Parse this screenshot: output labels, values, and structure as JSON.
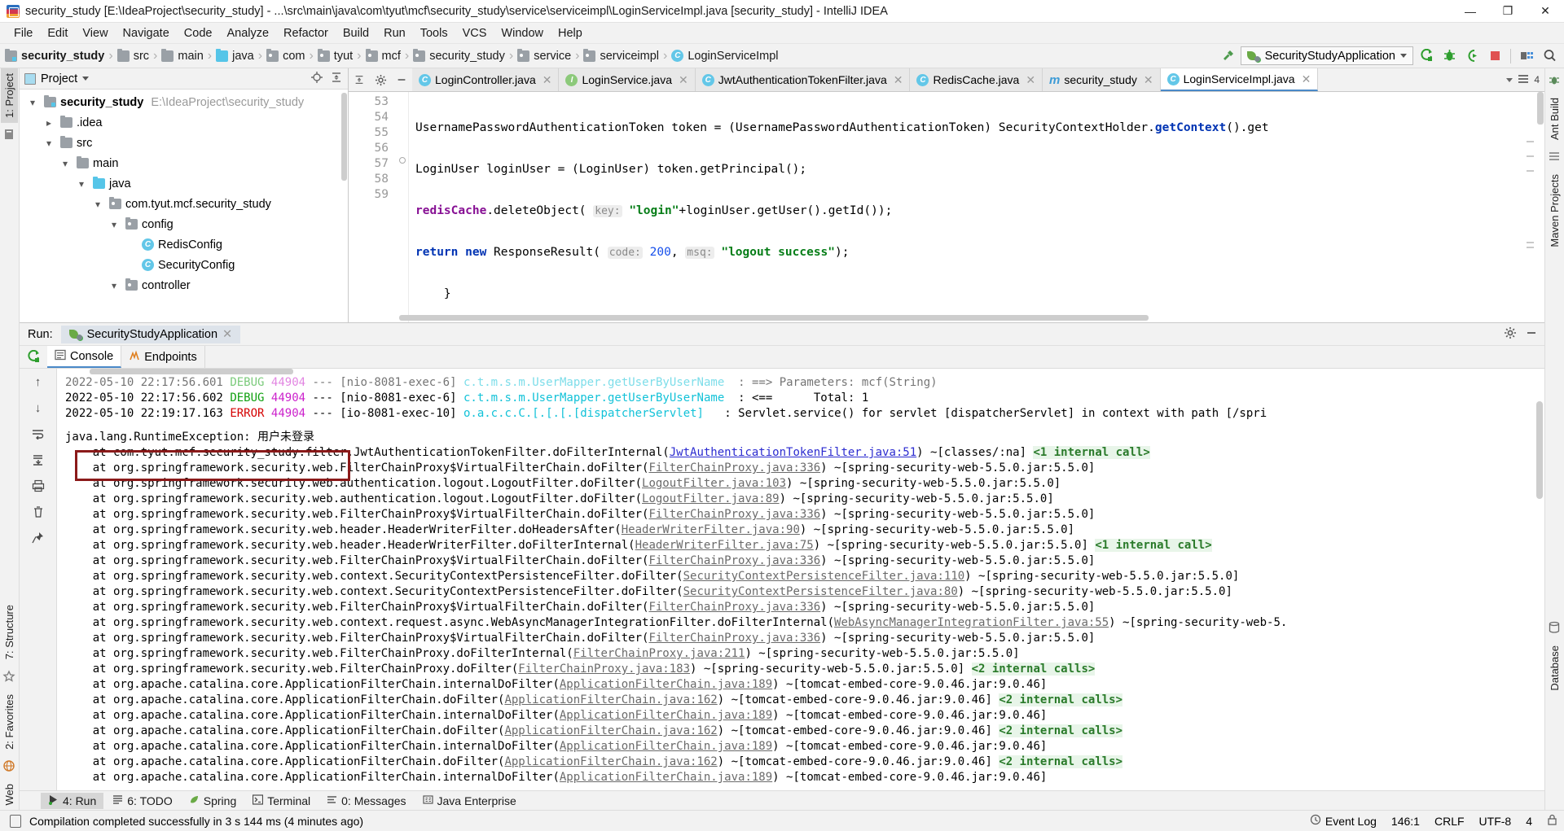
{
  "window": {
    "title": "security_study [E:\\IdeaProject\\security_study] - ...\\src\\main\\java\\com\\tyut\\mcf\\security_study\\service\\serviceimpl\\LoginServiceImpl.java [security_study] - IntelliJ IDEA",
    "minimize": "—",
    "maximize": "❐",
    "close": "✕"
  },
  "menu": {
    "items": [
      "File",
      "Edit",
      "View",
      "Navigate",
      "Code",
      "Analyze",
      "Refactor",
      "Build",
      "Run",
      "Tools",
      "VCS",
      "Window",
      "Help"
    ]
  },
  "breadcrumb": {
    "items": [
      {
        "label": "security_study",
        "icon": "module-icon",
        "bold": true
      },
      {
        "label": "src",
        "icon": "folder-icon",
        "bold": false
      },
      {
        "label": "main",
        "icon": "folder-icon",
        "bold": false
      },
      {
        "label": "java",
        "icon": "source-folder-icon",
        "bold": false
      },
      {
        "label": "com",
        "icon": "package-icon",
        "bold": false
      },
      {
        "label": "tyut",
        "icon": "package-icon",
        "bold": false
      },
      {
        "label": "mcf",
        "icon": "package-icon",
        "bold": false
      },
      {
        "label": "security_study",
        "icon": "package-icon",
        "bold": false
      },
      {
        "label": "service",
        "icon": "package-icon",
        "bold": false
      },
      {
        "label": "serviceimpl",
        "icon": "package-icon",
        "bold": false
      },
      {
        "label": "LoginServiceImpl",
        "icon": "class-icon",
        "bold": false
      }
    ]
  },
  "toolbar": {
    "run_config": "SecurityStudyApplication",
    "buttons": [
      "run-button",
      "debug-button",
      "run-with-coverage-button",
      "stop-button",
      "project-structure-button",
      "search-everywhere-button"
    ]
  },
  "project_panel": {
    "title": "Project",
    "tree": [
      {
        "depth": 0,
        "label": "security_study",
        "path": "E:\\IdeaProject\\security_study",
        "icon": "module-icon",
        "expanded": true,
        "bold": true
      },
      {
        "depth": 1,
        "label": ".idea",
        "path": "",
        "icon": "folder-icon",
        "expanded": false,
        "bold": false
      },
      {
        "depth": 1,
        "label": "src",
        "path": "",
        "icon": "folder-icon",
        "expanded": true,
        "bold": false
      },
      {
        "depth": 2,
        "label": "main",
        "path": "",
        "icon": "folder-icon",
        "expanded": true,
        "bold": false
      },
      {
        "depth": 3,
        "label": "java",
        "path": "",
        "icon": "source-folder-icon",
        "expanded": true,
        "bold": false
      },
      {
        "depth": 4,
        "label": "com.tyut.mcf.security_study",
        "path": "",
        "icon": "package-icon",
        "expanded": true,
        "bold": false
      },
      {
        "depth": 5,
        "label": "config",
        "path": "",
        "icon": "package-icon",
        "expanded": true,
        "bold": false
      },
      {
        "depth": 6,
        "label": "RedisConfig",
        "path": "",
        "icon": "class-icon",
        "expanded": null,
        "bold": false
      },
      {
        "depth": 6,
        "label": "SecurityConfig",
        "path": "",
        "icon": "class-icon",
        "expanded": null,
        "bold": false
      },
      {
        "depth": 5,
        "label": "controller",
        "path": "",
        "icon": "package-icon",
        "expanded": true,
        "bold": false
      }
    ]
  },
  "editor": {
    "tabs": [
      {
        "label": "LoginController.java",
        "icon": "class-icon",
        "active": false
      },
      {
        "label": "LoginService.java",
        "icon": "interface-icon",
        "active": false
      },
      {
        "label": "JwtAuthenticationTokenFilter.java",
        "icon": "class-icon",
        "active": false
      },
      {
        "label": "RedisCache.java",
        "icon": "class-icon",
        "active": false
      },
      {
        "label": "security_study",
        "icon": "maven-icon",
        "active": false
      },
      {
        "label": "LoginServiceImpl.java",
        "icon": "class-icon",
        "active": true
      }
    ],
    "inspection_count": "4",
    "lines": [
      {
        "number": "53",
        "current": false
      },
      {
        "number": "54",
        "current": false
      },
      {
        "number": "55",
        "current": false
      },
      {
        "number": "56",
        "current": false
      },
      {
        "number": "57",
        "current": false
      },
      {
        "number": "58",
        "current": false
      },
      {
        "number": "59",
        "current": true
      }
    ],
    "code": {
      "l53_a": "UsernamePasswordAuthenticationToken token = (UsernamePasswordAuthenticationToken) SecurityContextHolder.",
      "l53_b": "getContext",
      "l53_c": "().get",
      "l54": "LoginUser loginUser = (LoginUser) token.getPrincipal();",
      "l55_field": "redisCache",
      "l55_mid": ".deleteObject(",
      "l55_hint": "key:",
      "l55_str": "\"login\"",
      "l55_tail": "+loginUser.getUser().getId());",
      "l56_kw1": "return",
      "l56_kw2": "new",
      "l56_mid": " ResponseResult(",
      "l56_hint1": "code:",
      "l56_num": "200",
      "l56_comma": ",",
      "l56_hint2": "msq:",
      "l56_str": "\"logout success\"",
      "l56_tail": ");",
      "l57": "    }",
      "l58": "}",
      "l59": ""
    }
  },
  "run_window": {
    "label": "Run:",
    "config_tab": "SecurityStudyApplication",
    "sub_tabs": [
      {
        "label": "Console",
        "icon": "console-icon",
        "active": true
      },
      {
        "label": "Endpoints",
        "icon": "endpoints-icon",
        "active": false
      }
    ],
    "console_lines": [
      {
        "kind": "log",
        "clipped": true,
        "datetime": "2022-05-10 22:17:56.601",
        "level": "DEBUG",
        "level_class": "c-debug",
        "pid": "44904",
        "dashes": "---",
        "thread": "[nio-8081-exec-6]",
        "logger": "c.t.m.s.m.UserMapper.getUserByUserName",
        "message": ": ==> Parameters: mcf(String)"
      },
      {
        "kind": "log",
        "clipped": false,
        "datetime": "2022-05-10 22:17:56.602",
        "level": "DEBUG",
        "level_class": "c-debug",
        "pid": "44904",
        "dashes": "---",
        "thread": "[nio-8081-exec-6]",
        "logger": "c.t.m.s.m.UserMapper.getUserByUserName",
        "message": ": <==      Total: 1"
      },
      {
        "kind": "log",
        "clipped": false,
        "datetime": "2022-05-10 22:19:17.163",
        "level": "ERROR",
        "level_class": "c-error",
        "pid": "44904",
        "dashes": "---",
        "thread": "[io-8081-exec-10]",
        "logger": "o.a.c.c.C.[.[.[.[dispatcherServlet]",
        "message": ": Servlet.service() for servlet [dispatcherServlet] in context with path [/spri"
      }
    ],
    "exception_header": "java.lang.RuntimeException: 用户未登录",
    "exception_box_color": "#8b1a1a",
    "stack_trace": [
      {
        "pre": "    at com.tyut.mcf.security_study.filter.JwtAuthenticationTokenFilter.doFilterInternal(",
        "link": "JwtAuthenticationTokenFilter.java:51",
        "link_style": "blue",
        "post": ") ~[classes/:na] ",
        "badge": "<1 internal call>"
      },
      {
        "pre": "    at org.springframework.security.web.FilterChainProxy$VirtualFilterChain.doFilter(",
        "link": "FilterChainProxy.java:336",
        "link_style": "gray",
        "post": ") ~[spring-security-web-5.5.0.jar:5.5.0]",
        "badge": ""
      },
      {
        "pre": "    at org.springframework.security.web.authentication.logout.LogoutFilter.doFilter(",
        "link": "LogoutFilter.java:103",
        "link_style": "gray",
        "post": ") ~[spring-security-web-5.5.0.jar:5.5.0]",
        "badge": ""
      },
      {
        "pre": "    at org.springframework.security.web.authentication.logout.LogoutFilter.doFilter(",
        "link": "LogoutFilter.java:89",
        "link_style": "gray",
        "post": ") ~[spring-security-web-5.5.0.jar:5.5.0]",
        "badge": ""
      },
      {
        "pre": "    at org.springframework.security.web.FilterChainProxy$VirtualFilterChain.doFilter(",
        "link": "FilterChainProxy.java:336",
        "link_style": "gray",
        "post": ") ~[spring-security-web-5.5.0.jar:5.5.0]",
        "badge": ""
      },
      {
        "pre": "    at org.springframework.security.web.header.HeaderWriterFilter.doHeadersAfter(",
        "link": "HeaderWriterFilter.java:90",
        "link_style": "gray",
        "post": ") ~[spring-security-web-5.5.0.jar:5.5.0]",
        "badge": ""
      },
      {
        "pre": "    at org.springframework.security.web.header.HeaderWriterFilter.doFilterInternal(",
        "link": "HeaderWriterFilter.java:75",
        "link_style": "gray",
        "post": ") ~[spring-security-web-5.5.0.jar:5.5.0] ",
        "badge": "<1 internal call>"
      },
      {
        "pre": "    at org.springframework.security.web.FilterChainProxy$VirtualFilterChain.doFilter(",
        "link": "FilterChainProxy.java:336",
        "link_style": "gray",
        "post": ") ~[spring-security-web-5.5.0.jar:5.5.0]",
        "badge": ""
      },
      {
        "pre": "    at org.springframework.security.web.context.SecurityContextPersistenceFilter.doFilter(",
        "link": "SecurityContextPersistenceFilter.java:110",
        "link_style": "gray",
        "post": ") ~[spring-security-web-5.5.0.jar:5.5.0]",
        "badge": ""
      },
      {
        "pre": "    at org.springframework.security.web.context.SecurityContextPersistenceFilter.doFilter(",
        "link": "SecurityContextPersistenceFilter.java:80",
        "link_style": "gray",
        "post": ") ~[spring-security-web-5.5.0.jar:5.5.0]",
        "badge": ""
      },
      {
        "pre": "    at org.springframework.security.web.FilterChainProxy$VirtualFilterChain.doFilter(",
        "link": "FilterChainProxy.java:336",
        "link_style": "gray",
        "post": ") ~[spring-security-web-5.5.0.jar:5.5.0]",
        "badge": ""
      },
      {
        "pre": "    at org.springframework.security.web.context.request.async.WebAsyncManagerIntegrationFilter.doFilterInternal(",
        "link": "WebAsyncManagerIntegrationFilter.java:55",
        "link_style": "gray",
        "post": ") ~[spring-security-web-5.",
        "badge": ""
      },
      {
        "pre": "    at org.springframework.security.web.FilterChainProxy$VirtualFilterChain.doFilter(",
        "link": "FilterChainProxy.java:336",
        "link_style": "gray",
        "post": ") ~[spring-security-web-5.5.0.jar:5.5.0]",
        "badge": ""
      },
      {
        "pre": "    at org.springframework.security.web.FilterChainProxy.doFilterInternal(",
        "link": "FilterChainProxy.java:211",
        "link_style": "gray",
        "post": ") ~[spring-security-web-5.5.0.jar:5.5.0]",
        "badge": ""
      },
      {
        "pre": "    at org.springframework.security.web.FilterChainProxy.doFilter(",
        "link": "FilterChainProxy.java:183",
        "link_style": "gray",
        "post": ") ~[spring-security-web-5.5.0.jar:5.5.0] ",
        "badge": "<2 internal calls>"
      },
      {
        "pre": "    at org.apache.catalina.core.ApplicationFilterChain.internalDoFilter(",
        "link": "ApplicationFilterChain.java:189",
        "link_style": "gray",
        "post": ") ~[tomcat-embed-core-9.0.46.jar:9.0.46]",
        "badge": ""
      },
      {
        "pre": "    at org.apache.catalina.core.ApplicationFilterChain.doFilter(",
        "link": "ApplicationFilterChain.java:162",
        "link_style": "gray",
        "post": ") ~[tomcat-embed-core-9.0.46.jar:9.0.46] ",
        "badge": "<2 internal calls>"
      },
      {
        "pre": "    at org.apache.catalina.core.ApplicationFilterChain.internalDoFilter(",
        "link": "ApplicationFilterChain.java:189",
        "link_style": "gray",
        "post": ") ~[tomcat-embed-core-9.0.46.jar:9.0.46]",
        "badge": ""
      },
      {
        "pre": "    at org.apache.catalina.core.ApplicationFilterChain.doFilter(",
        "link": "ApplicationFilterChain.java:162",
        "link_style": "gray",
        "post": ") ~[tomcat-embed-core-9.0.46.jar:9.0.46] ",
        "badge": "<2 internal calls>"
      },
      {
        "pre": "    at org.apache.catalina.core.ApplicationFilterChain.internalDoFilter(",
        "link": "ApplicationFilterChain.java:189",
        "link_style": "gray",
        "post": ") ~[tomcat-embed-core-9.0.46.jar:9.0.46]",
        "badge": ""
      },
      {
        "pre": "    at org.apache.catalina.core.ApplicationFilterChain.doFilter(",
        "link": "ApplicationFilterChain.java:162",
        "link_style": "gray",
        "post": ") ~[tomcat-embed-core-9.0.46.jar:9.0.46] ",
        "badge": "<2 internal calls>"
      },
      {
        "pre": "    at org.apache.catalina.core.ApplicationFilterChain.internalDoFilter(",
        "link": "ApplicationFilterChain.java:189",
        "link_style": "gray",
        "post": ") ~[tomcat-embed-core-9.0.46.jar:9.0.46]",
        "badge": ""
      }
    ]
  },
  "left_strip": {
    "tabs": [
      {
        "label": "1: Project",
        "active": true
      },
      {
        "label": "7: Structure",
        "active": false
      },
      {
        "label": "2: Favorites",
        "active": false
      },
      {
        "label": "Web",
        "active": false
      }
    ]
  },
  "right_strip": {
    "tabs": [
      {
        "label": "Ant Build",
        "active": false
      },
      {
        "label": "Maven Projects",
        "active": false
      },
      {
        "label": "Database",
        "active": false
      }
    ]
  },
  "bottom_tools": {
    "items": [
      {
        "label": "4: Run",
        "icon": "run-icon",
        "active": true
      },
      {
        "label": "6: TODO",
        "icon": "todo-icon",
        "active": false
      },
      {
        "label": "Spring",
        "icon": "spring-icon",
        "active": false
      },
      {
        "label": "Terminal",
        "icon": "terminal-icon",
        "active": false
      },
      {
        "label": "0: Messages",
        "icon": "messages-icon",
        "active": false
      },
      {
        "label": "Java Enterprise",
        "icon": "java-enterprise-icon",
        "active": false
      }
    ]
  },
  "status_bar": {
    "message": "Compilation completed successfully in 3 s 144 ms (4 minutes ago)",
    "event_log": "Event Log",
    "caret_position": "146:1",
    "line_separator": "CRLF",
    "encoding": "UTF-8",
    "indent": "4"
  }
}
